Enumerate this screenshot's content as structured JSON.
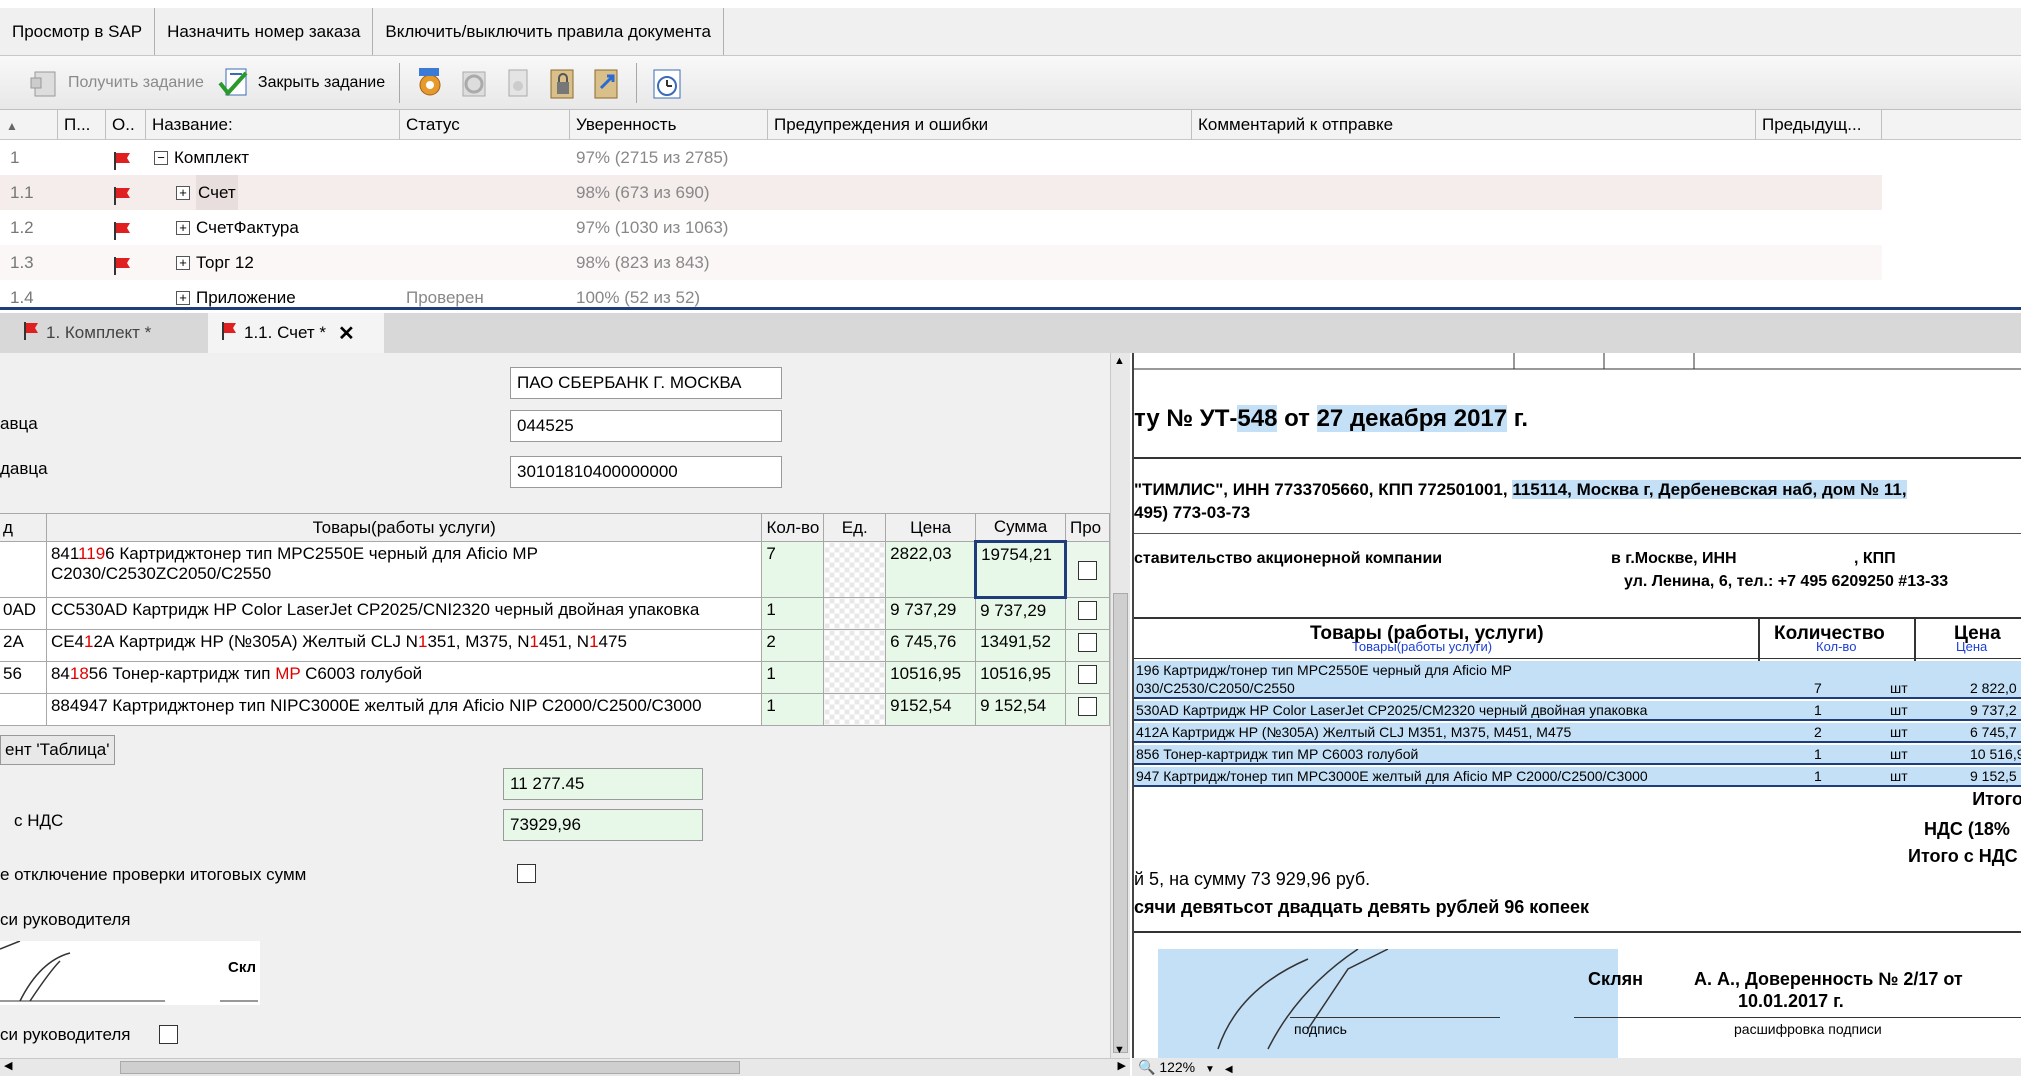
{
  "menubar": [
    "Просмотр в SAP",
    "Назначить номер заказа",
    "Включить/выключить правила документа"
  ],
  "toolbar": {
    "get_task": "Получить задание",
    "close_task": "Закрыть задание"
  },
  "tree": {
    "columns": [
      "П...",
      "О..",
      "Название:",
      "Статус",
      "Уверенность",
      "Предупреждения и ошибки",
      "Комментарий к отправке",
      "Предыдущ..."
    ],
    "rows": [
      {
        "num": "1",
        "name": "Комплект",
        "status": "",
        "conf": "97% (2715 из 2785)",
        "flag": true
      },
      {
        "num": "1.1",
        "name": "Счет",
        "status": "",
        "conf": "98% (673 из 690)",
        "flag": true
      },
      {
        "num": "1.2",
        "name": "СчетФактура",
        "status": "",
        "conf": "97% (1030 из 1063)",
        "flag": true
      },
      {
        "num": "1.3",
        "name": "Торг 12",
        "status": "",
        "conf": "98% (823 из 843)",
        "flag": true
      },
      {
        "num": "1.4",
        "name": "Приложение",
        "status": "Проверен",
        "conf": "100% (52 из 52)",
        "flag": false
      }
    ]
  },
  "doctabs": {
    "tab1": "1. Комплект *",
    "tab2": "1.1. Счет *"
  },
  "form": {
    "bank": "ПАО СБЕРБАНК Г. МОСКВА",
    "bik_label": "авца",
    "bik": "044525",
    "acct_label": "давца",
    "acct": "30101810400000000",
    "goods_headers": [
      "д",
      "Товары(работы услуги)",
      "Кол-во",
      "Ед.",
      "Цена",
      "Сумма",
      "Про"
    ],
    "goods": [
      {
        "code": "",
        "pre": "841",
        "r1": "1",
        "mid": "19",
        "post": "6 Картриджтонер тип MPC2550E черный для Aficio MP",
        "line2": "C2030/C2530ZC2050/C2550",
        "qty": "7",
        "price": "2822,03",
        "sum": "19754,21"
      },
      {
        "code": "0AD",
        "text": "CC530AD Картридж HP Color LaserJet CP2025/CNI2320 черный двойная упаковка",
        "qty": "1",
        "price": "9 737,29",
        "sum": "9 737,29"
      },
      {
        "code": "2A",
        "text_a": "CE4",
        "r_a": "1",
        "text_b": "2А Картридж HP (№305А) Желтый CLJ N",
        "r_b": "1",
        "text_c": "351, M375, N",
        "r_c": "1",
        "text_d": "451, N",
        "r_d": "1",
        "text_e": "475",
        "qty": "2",
        "price": "6 745,76",
        "sum": "13491,52"
      },
      {
        "code": "56",
        "text_a": "84",
        "r_a": "18",
        "text_b": "56 Тонер-картридж тип ",
        "r_b": "MP",
        "text_c": " C6003 голубой",
        "qty": "1",
        "price": "10516,95",
        "sum": "10516,95"
      },
      {
        "code": "",
        "text": "884947 Картриджтонер тип NIPC3000E желтый для Aficio NIP C2000/C2500/C3000",
        "qty": "1",
        "price": "9152,54",
        "sum": "9 152,54"
      }
    ],
    "table_btn": "ент 'Таблица'",
    "vat": "11 277.45",
    "total_label": "с НДС",
    "total": "73929,96",
    "check_label": "е отключение проверки итоговых сумм",
    "sign_label": "си руководителя",
    "sign_name": "Скл",
    "sign_label2": "си руководителя"
  },
  "preview": {
    "title_pre": "ту № УТ-",
    "title_num": "548",
    "title_mid": " от ",
    "title_date": "27 декабря 2017",
    "title_post": " г.",
    "seller_pre": "\"ТИМЛИС\", ИНН 7733705660, КПП 772501001, ",
    "seller_addr": "115114, Москва г, Дербеневская наб, дом № 11,",
    "phone": "495) 773-03-73",
    "buyer": "ставительство акционерной компании",
    "buyer_city": "в г.Москве, ИНН",
    "kpp": ", КПП",
    "buyer_addr": "ул. Ленина, 6, тел.: +7 495 6209250 #13-33",
    "th_goods": "Товары (работы, услуги)",
    "th_goods_ocr": "Товары(работы услуги)",
    "th_qty": "Количество",
    "th_qty_ocr": "Кол-во",
    "th_price": "Цена",
    "th_price_ocr": "Цена",
    "rows": [
      {
        "t": "196 Картридж/тонер тип MPC2550E черный для Aficio MP",
        "t2": "030/C2530/C2050/C2550",
        "q": "7",
        "u": "шт",
        "p": "2 822,0"
      },
      {
        "t": "530AD Картридж HP Color LaserJet CP2025/CM2320 черный двойная упаковка",
        "q": "1",
        "u": "шт",
        "p": "9 737,2"
      },
      {
        "t": "412A Картридж HP (№305A) Желтый CLJ M351, M375, M451, M475",
        "q": "2",
        "u": "шт",
        "p": "6 745,7"
      },
      {
        "t": "856 Тонер-картридж тип MP C6003 голубой",
        "q": "1",
        "u": "шт",
        "p": "10 516,9"
      },
      {
        "t": "947 Картридж/тонер тип MPC3000E желтый для Aficio MP C2000/C2500/C3000",
        "q": "1",
        "u": "шт",
        "p": "9 152,5"
      }
    ],
    "itogo": "Итого",
    "nds": "НДС (18%",
    "itogo_nds": "Итого с НДС",
    "sum_line": "й 5, на сумму 73 929,96 руб.",
    "words_line": "сячи девятьсот двадцать девять рублей 96 копеек",
    "signer": "Склян",
    "attorney": "А. А., Доверенность № 2/17 от",
    "attorney_date": "10.01.2017 г.",
    "podpis": "подпись",
    "rasshifrovka": "расшифровка подписи",
    "zoom": "122%"
  }
}
